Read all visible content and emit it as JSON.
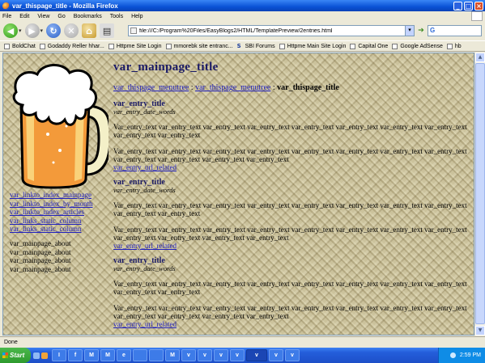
{
  "window": {
    "title": "var_thispage_title - Mozilla Firefox"
  },
  "menu": [
    "File",
    "Edit",
    "View",
    "Go",
    "Bookmarks",
    "Tools",
    "Help"
  ],
  "navbar": {
    "url": "file:///C:/Program%20Files/EasyBlogs2/HTML/TemplatePreview/2entries.html",
    "search_value": "G"
  },
  "bookmarks": [
    {
      "label": "BoldChat",
      "icon": "page-icon"
    },
    {
      "label": "Godaddy Reller hhar...",
      "icon": "page-icon"
    },
    {
      "label": "Httpme Site Login",
      "icon": "page-icon"
    },
    {
      "label": "mmorebk site entranc...",
      "icon": "page-icon"
    },
    {
      "label": "SBI Forums",
      "icon": "sbi-icon"
    },
    {
      "label": "Httpme Main Site Login",
      "icon": "page-icon"
    },
    {
      "label": "Capital One",
      "icon": "page-icon"
    },
    {
      "label": "Google AdSense",
      "icon": "page-icon"
    },
    {
      "label": "hb",
      "icon": "page-icon"
    }
  ],
  "page": {
    "title": "var_mainpage_title",
    "left_links": [
      "var_linkto_index_mainpage",
      "var_linkto_index_by_month",
      "var_linkto_index_articles",
      "var_links_static_column",
      "var_links_static_column"
    ],
    "about": [
      "var_mainpage_about",
      "var_mainpage_about",
      "var_mainpage_about",
      "var_mainpage_about"
    ],
    "breadcrumb": {
      "link1": "var_thispage_menutree",
      "sep1": " : ",
      "link2": "var_thispage_menutree",
      "sep2": " : ",
      "current": "var_thispage_title"
    },
    "entries": [
      {
        "title": "var_entry_title",
        "date": "var_entry_date_words",
        "text1": "Var_entry_text var_entry_text var_entry_text var_entry_text var_entry_text var_entry_text var_entry_text var_entry_text var_entry_text var_entry_text",
        "text2": "Var_entry_text var_entry_text var_entry_text var_entry_text var_entry_text var_entry_text var_entry_text var_entry_text var_entry_text var_entry_text var_entry_text var_entry_text",
        "link": "var_entry_url_related"
      },
      {
        "title": "var_entry_title",
        "date": "var_entry_date_words",
        "text1": "Var_entry_text var_entry_text var_entry_text var_entry_text var_entry_text var_entry_text var_entry_text var_entry_text var_entry_text var_entry_text",
        "text2": "Var_entry_text var_entry_text var_entry_text var_entry_text var_entry_text var_entry_text var_entry_text var_entry_text var_entry_text var_entry_text var_entry_text var_entry_text",
        "link": "var_entry_url_related"
      },
      {
        "title": "var_entry_title",
        "date": "var_entry_date_words",
        "text1": "Var_entry_text var_entry_text var_entry_text var_entry_text var_entry_text var_entry_text var_entry_text var_entry_text var_entry_text var_entry_text",
        "text2": "Var_entry_text var_entry_text var_entry_text var_entry_text var_entry_text var_entry_text var_entry_text var_entry_text var_entry_text var_entry_text var_entry_text var_entry_text",
        "link": "var_entry_url_related"
      }
    ]
  },
  "status": {
    "text": "Done"
  },
  "taskbar": {
    "start_label": "Start",
    "tasks": [
      "I",
      "f",
      "M",
      "M",
      "e",
      "",
      "",
      "M",
      "v",
      "v",
      "v",
      "v",
      "v",
      "v",
      "v"
    ],
    "active_task": "v",
    "clock": "2:59 PM"
  }
}
